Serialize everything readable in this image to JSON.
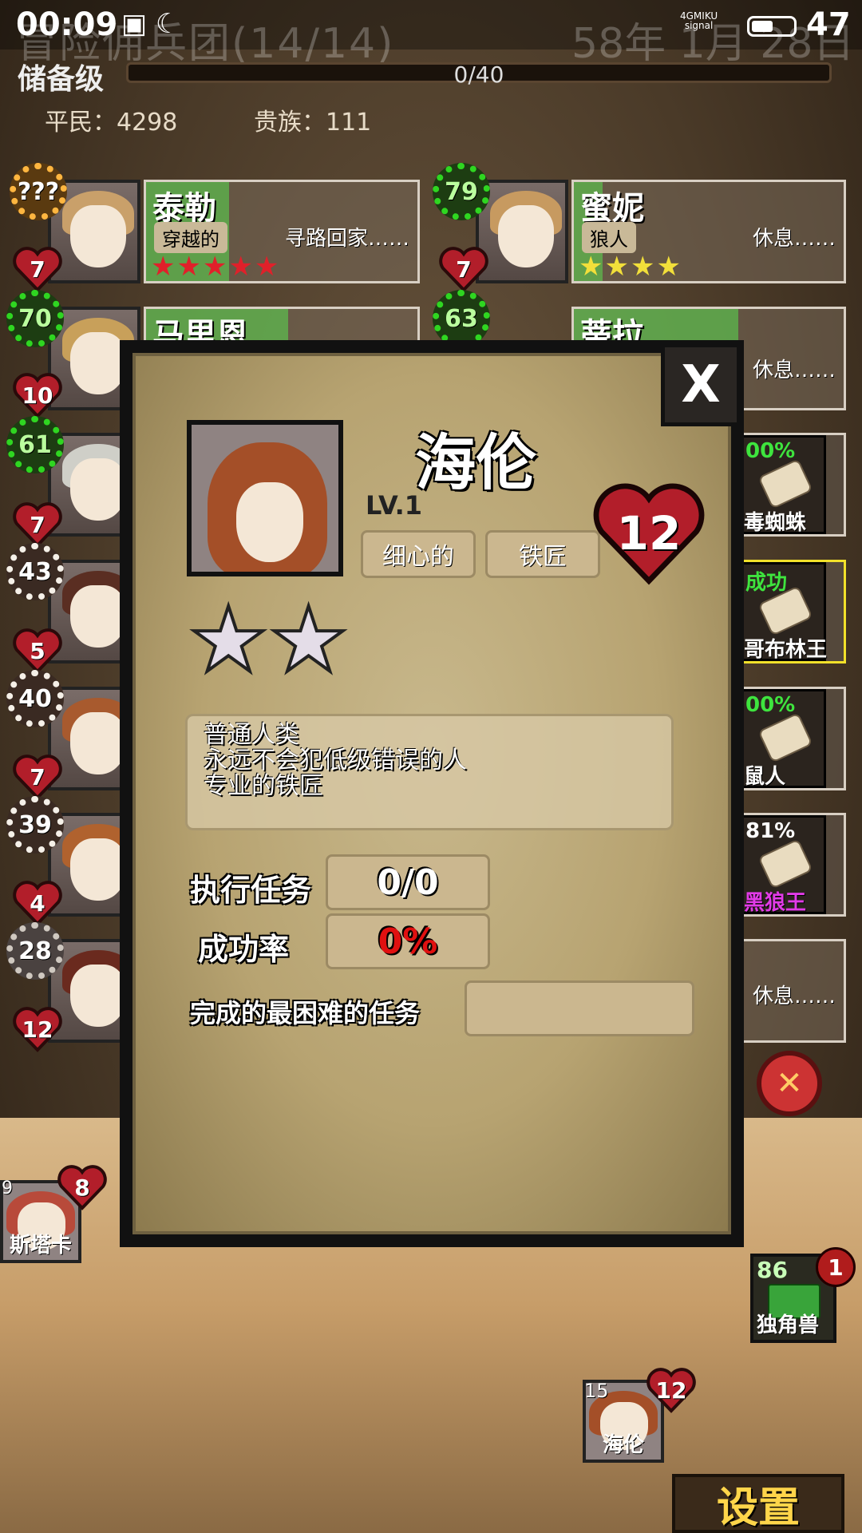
{
  "status_bar": {
    "time": "00:09",
    "icons": "▣ ☾",
    "network": "4GMIKU",
    "network_sub": "signal",
    "battery": "47",
    "ghost_left": "冒险佣兵团(14/14)",
    "ghost_right": "58年 1月 28日"
  },
  "reserve": {
    "label": "储备级",
    "progress_text": "0/40",
    "progress": 0
  },
  "population": {
    "commoners": "平民：4298",
    "nobles": "贵族：111"
  },
  "roster": [
    {
      "name": "泰勒",
      "trait": "穿越的",
      "status": "寻路回家……",
      "level": "???",
      "hp": "7",
      "stars": "★★★★★",
      "star_color": "#e0202a"
    },
    {
      "name": "蜜妮",
      "trait": "狼人",
      "status": "休息……",
      "level": "79",
      "hp": "7",
      "stars": "★★★★",
      "star_color": "#f2df3a"
    },
    {
      "name": "马里恩",
      "level": "70",
      "hp": "10"
    },
    {
      "name": "蒂拉",
      "status": "休息……",
      "level": "63"
    },
    {
      "level": "61",
      "hp": "7"
    },
    {
      "level": "43",
      "hp": "5"
    },
    {
      "level": "40",
      "hp": "7"
    },
    {
      "level": "39",
      "hp": "4"
    },
    {
      "level": "28",
      "hp": "12"
    }
  ],
  "quests": [
    {
      "pct": "00%",
      "name": "毒蜘蛛"
    },
    {
      "pct": "成功",
      "name": "哥布林王"
    },
    {
      "pct": "00%",
      "name": "鼠人"
    },
    {
      "pct": "81%",
      "name": "黑狼王"
    },
    {
      "status": "休息……"
    }
  ],
  "modal": {
    "close_label": "X",
    "name": "海伦",
    "level": "LV.1",
    "tags": [
      "细心的",
      "铁匠"
    ],
    "hp": "12",
    "stars": "★★",
    "star_count": 2,
    "description": [
      "普通人类",
      "永远不会犯低级错误的人",
      "专业的铁匠"
    ],
    "missions_label": "执行任务",
    "missions_value": "0/0",
    "success_label": "成功率",
    "success_value": "0%",
    "hardest_label": "完成的最困难的任务",
    "hardest_value": ""
  },
  "bottom": {
    "left_hero_name": "斯塔卡",
    "left_hero_hp": "8",
    "left_hero_level": "9",
    "hero_name": "海伦",
    "hero_level": "15",
    "hero_hp": "12",
    "unicorn_num": "86",
    "unicorn_name": "独角兽",
    "unicorn_badge": "1",
    "settings_label": "设置"
  },
  "colors": {
    "success_red": "#e01010",
    "quest_green": "#3ee43e",
    "settings_gold": "#ffd54a"
  }
}
